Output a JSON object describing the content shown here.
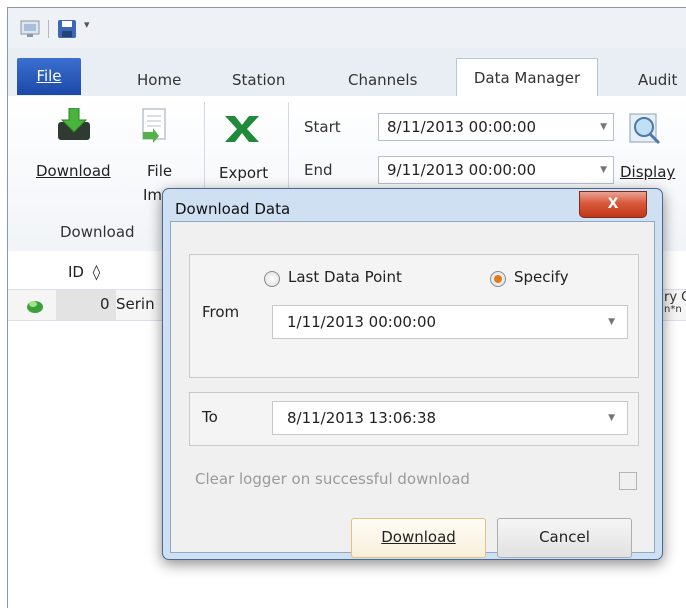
{
  "ribbon": {
    "tabs": [
      "Home",
      "Station",
      "Channels",
      "Data Manager",
      "Audit"
    ],
    "file_tab": "File",
    "download_label": "Download",
    "file_import_label_1": "File",
    "file_import_label_2": "Import",
    "export_label": "Export",
    "start_label": "Start",
    "end_label": "End",
    "start_value": "8/11/2013 00:00:00",
    "end_value": "9/11/2013 00:00:00",
    "display_label": "Display",
    "group_download_label": "Download"
  },
  "grid": {
    "id_header": "ID",
    "row_id": "0",
    "row_text": "Serin",
    "right_fragment_1": "ry C",
    "right_fragment_2": "n*n"
  },
  "dialog": {
    "title": "Download Data",
    "close_glyph": "X",
    "from_label": "From",
    "last_data_point_label": "Last Data Point",
    "specify_label": "Specify",
    "selected_option": "Specify",
    "from_value": "1/11/2013 00:00:00",
    "to_label": "To",
    "to_value": "8/11/2013 13:06:38",
    "clear_logger_label": "Clear logger on successful download",
    "clear_logger_checked": false,
    "download_button": "Download",
    "cancel_button": "Cancel"
  },
  "colors": {
    "file_tab": "#2d5fc2",
    "dialog_frame": "#cfe0f3",
    "close_button": "#d3472b",
    "radio_selected": "#e07b1e"
  }
}
